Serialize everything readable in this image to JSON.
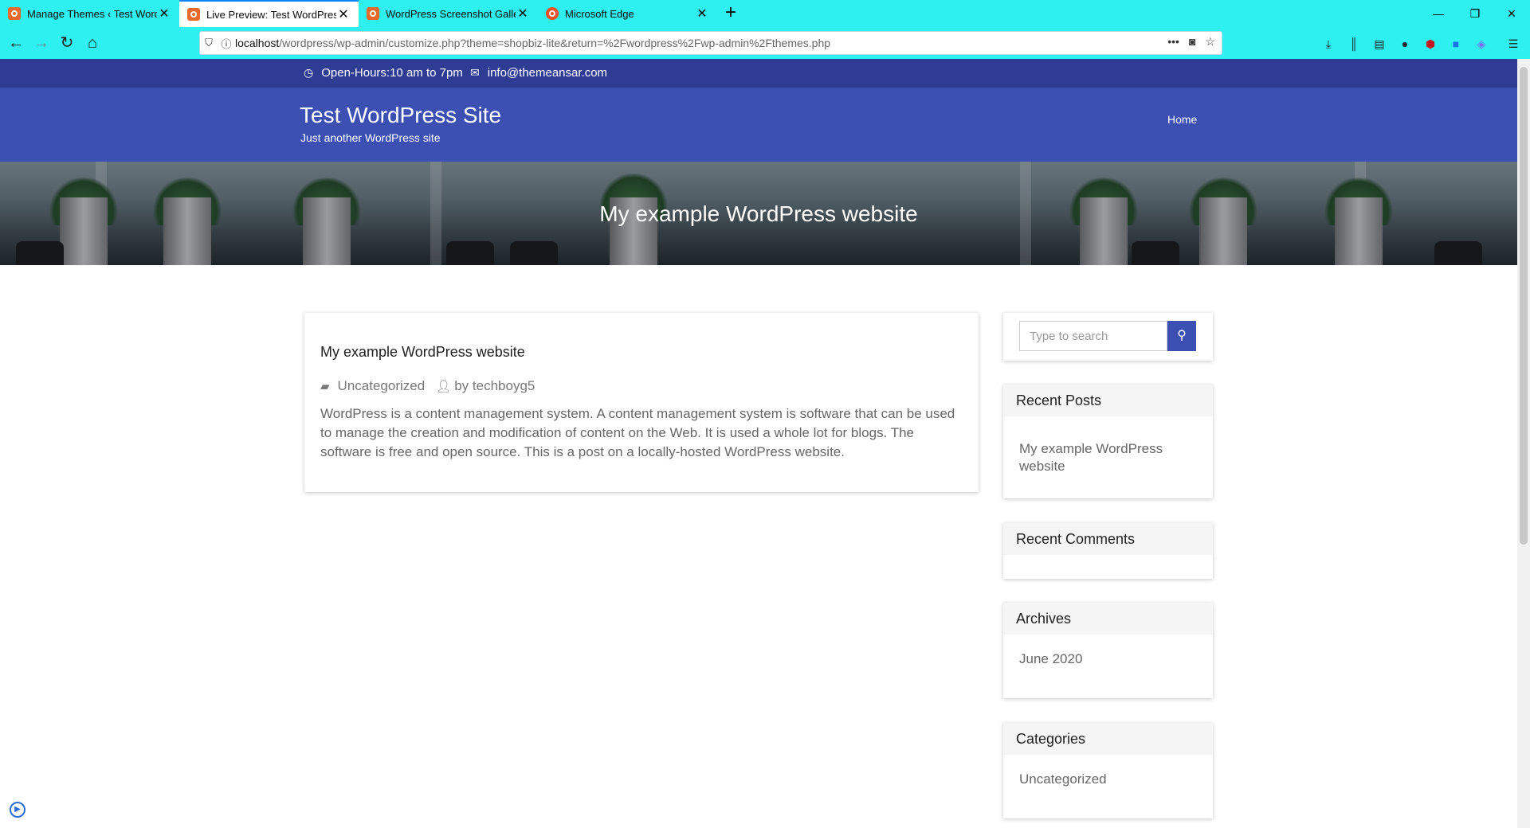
{
  "browser": {
    "tabs": [
      {
        "label": "Manage Themes ‹ Test WordPr",
        "active": false
      },
      {
        "label": "Live Preview: Test WordPress S",
        "active": true
      },
      {
        "label": "WordPress Screenshot Gallery",
        "active": false
      },
      {
        "label": "Microsoft Edge",
        "active": false
      }
    ],
    "url_host": "localhost",
    "url_path": "/wordpress/wp-admin/customize.php?theme=shopbiz-lite&return=%2Fwordpress%2Fwp-admin%2Fthemes.php",
    "accent_color": "#2ff0f0"
  },
  "site": {
    "topbar": {
      "hours": "Open-Hours:10 am to 7pm",
      "email": "info@themeansar.com"
    },
    "title": "Test WordPress Site",
    "tagline": "Just another WordPress site",
    "menu": [
      "Home"
    ],
    "hero_title": "My example WordPress website",
    "colors": {
      "topbar": "#2f3c94",
      "header": "#3c50b4"
    }
  },
  "post": {
    "title": "My example WordPress website",
    "category": "Uncategorized",
    "author": "by techboyg5",
    "excerpt": "WordPress is a content management system. A content management system is software that can be used to manage the creation and modification of content on the Web. It is used a whole lot for blogs. The software is free and open source. This is a post on a locally-hosted WordPress website."
  },
  "sidebar": {
    "search_placeholder": "Type to search",
    "widgets": [
      {
        "title": "Recent Posts",
        "item": "My example WordPress website"
      },
      {
        "title": "Recent Comments",
        "item": ""
      },
      {
        "title": "Archives",
        "item": "June 2020"
      },
      {
        "title": "Categories",
        "item": "Uncategorized"
      }
    ]
  }
}
